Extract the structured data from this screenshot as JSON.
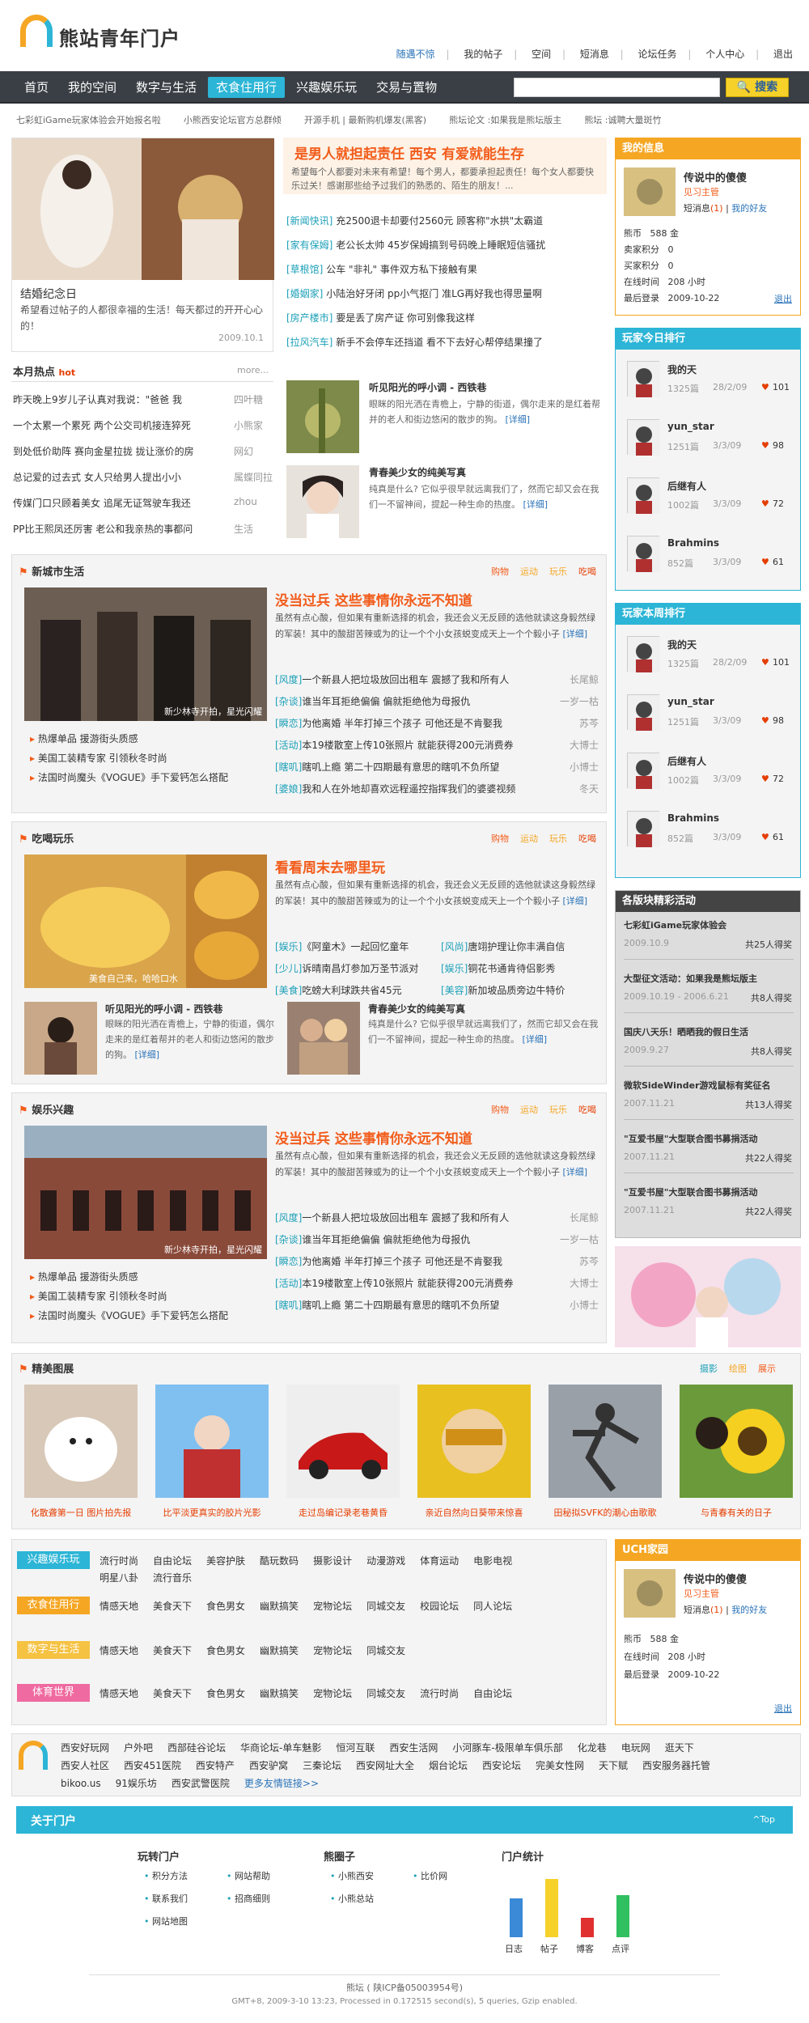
{
  "header": {
    "logo_text": "熊站青年门户",
    "top_links": [
      "随遇不惊",
      "我的帖子",
      "空间",
      "短消息",
      "论坛任务",
      "个人中心",
      "退出"
    ]
  },
  "nav": {
    "items": [
      "首页",
      "我的空间",
      "数字与生活",
      "衣食住用行",
      "兴趣娱乐玩",
      "交易与置物"
    ],
    "active_index": 3,
    "search_label": "搜索"
  },
  "ticker": [
    "七彩虹iGame玩家体验会开始报名啦",
    "小熊西安论坛官方总群倾",
    "开源手机 | 最新购机爆发(黑客)",
    "熊坛论文 :如果我是熊坛版主",
    "熊坛 :诚聘大量斑竹"
  ],
  "hero": {
    "caption_title": "结婚纪念日",
    "caption_text": "希望看过帖子的人都很幸福的生活！每天都过的开开心心的！",
    "date": "2009.10.1"
  },
  "headline": {
    "title": "是男人就担起责任  西安  有爱就能生存",
    "summary": "希望每个人都要对未来有希望！每个男人，都要承担起责任！每个女人都要快乐过关！感谢那些给予过我们的熟悉的、陌生的朋友！...",
    "news": [
      {
        "cat": "[新闻快讯]",
        "text": "充2500退卡却要付2560元 顾客称\"水拱\"太霸道"
      },
      {
        "cat": "[家有保姆]",
        "text": "老公长太帅 45岁保姆搞到号码晚上睡眠短信骚扰"
      },
      {
        "cat": "[草根馆]",
        "text": "公车 \"非礼\" 事件双方私下接触有果"
      },
      {
        "cat": "[婚姻家]",
        "text": "小陆治好牙闭 pp小气抠门 准LG再好我也得思量啊"
      },
      {
        "cat": "[房产楼市]",
        "text": "要是丢了房产证  你可别像我这样"
      },
      {
        "cat": "[拉风汽车]",
        "text": "新手不会停车还挡道  看不下去好心帮停结果撞了"
      }
    ],
    "feature1": {
      "title": "听见阳光的呼小调 - 西铁巷",
      "text": "眼眯的阳光洒在青檐上，宁静的街道，偶尔走来的是红着帮并的老人和街边悠闲的散步的狗。",
      "more": "[详细]"
    },
    "feature2": {
      "title": "青春美少女的纯美写真",
      "text": "纯真是什么? 它似乎很早就远离我们了，然而它却又会在我们一不留神间，提起一种生命的热度。",
      "more": "[详细]"
    }
  },
  "hot": {
    "title": "本月热点",
    "badge": "hot",
    "more": "more...",
    "items": [
      {
        "text": "昨天晚上9岁儿子认真对我说：\"爸爸 我",
        "author": "四叶糖"
      },
      {
        "text": "一个太累一个累死 两个公交司机接连猝死",
        "author": "小熊家"
      },
      {
        "text": "到处低价助阵 赛向金星拉拢 拢让涨价的房",
        "author": "网幻"
      },
      {
        "text": "总记爱的过去式 女人只给男人提出小小",
        "author": "属蝶同拉"
      },
      {
        "text": "传媒门口只顾着美女 追尾无证驾驶车我还",
        "author": "zhou"
      },
      {
        "text": "PP比王熙凤还厉害 老公和我亲热的事都问",
        "author": "生活"
      }
    ]
  },
  "sections": [
    {
      "title": "新城市生活",
      "tabs": [
        "购物",
        "运动",
        "玩乐",
        "吃喝"
      ],
      "img_caption": "新少林寺开拍，星光闪耀",
      "bullets": [
        "热爆单品 援游街头质感",
        "美国工装精专家 引领秋冬时尚",
        "法国时尚魔头《VOGUE》手下爱钙怎么搭配"
      ],
      "headline": "没当过兵  这些事情你永远不知道",
      "summary": "虽然有点心酸，但如果有重新选择的机会，我还会义无反顾的选他就读这身毅然绿的军装！其中的酸甜苦辣或为的让一个个小女孩蜕变成天上一个个毅小子",
      "more": "[详细]",
      "list": [
        {
          "cat": "[风度]",
          "text": "一个新县人把垃圾放回出租车 震撼了我和所有人",
          "author": "长尾鲸"
        },
        {
          "cat": "[杂谈]",
          "text": "谁当年耳拒绝偏偏 偏就拒绝他为母报仇",
          "author": "一岁一枯"
        },
        {
          "cat": "[瞬恋]",
          "text": "为他离婚  半年打掉三个孩子  可他还是不肯娶我",
          "author": "苏芩"
        },
        {
          "cat": "[活动]",
          "text": "本19楼散室上传10张照片 就能获得200元消费券",
          "author": "大博士"
        },
        {
          "cat": "[瞎叽]",
          "text": "瞎叽上瘾 第二十四期最有意思的瞎叽不负所望",
          "author": "小博士"
        },
        {
          "cat": "[婆娘]",
          "text": "我和人在外地却喜欢远程遥控指挥我们的婆婆视频",
          "author": "冬天"
        }
      ]
    },
    {
      "title": "吃喝玩乐",
      "tabs": [
        "购物",
        "运动",
        "玩乐",
        "吃喝"
      ],
      "img_caption": "美食自己来，哈哈口水",
      "headline": "看看周末去哪里玩",
      "summary": "虽然有点心酸，但如果有重新选择的机会，我还会义无反顾的选他就读这身毅然绿的军装！其中的酸甜苦辣或为的让一个个小女孩蜕变成天上一个个毅小子",
      "more": "[详细]",
      "grid": [
        {
          "cat": "[娱乐]",
          "text": "《阿童木》一起回忆童年"
        },
        {
          "cat": "[风尚]",
          "text": "唐翊护理让你丰满自信"
        },
        {
          "cat": "[少儿]",
          "text": "诉晴南昌灯参加万圣节派对"
        },
        {
          "cat": "[娱乐]",
          "text": "铜花书通肯待侣影秀"
        },
        {
          "cat": "[美食]",
          "text": "吃螃大利球跌共省45元"
        },
        {
          "cat": "[美容]",
          "text": "新加坡品质旁边牛特价"
        }
      ],
      "feature1": {
        "title": "听见阳光的呼小调 - 西铁巷",
        "text": "眼眯的阳光洒在青檐上，宁静的街道，偶尔走来的是红着帮并的老人和街边悠闲的散步的狗。",
        "more": "[详细]"
      },
      "feature2": {
        "title": "青春美少女的纯美写真",
        "text": "纯真是什么? 它似乎很早就远离我们了，然而它却又会在我们一不留神间，提起一种生命的热度。",
        "more": "[详细]"
      }
    },
    {
      "title": "娱乐兴趣",
      "tabs": [
        "购物",
        "运动",
        "玩乐",
        "吃喝"
      ],
      "img_caption": "新少林寺开拍，星光闪耀",
      "bullets": [
        "热爆单品 援游街头质感",
        "美国工装精专家 引领秋冬时尚",
        "法国时尚魔头《VOGUE》手下爱钙怎么搭配"
      ],
      "headline": "没当过兵  这些事情你永远不知道",
      "summary": "虽然有点心酸，但如果有重新选择的机会，我还会义无反顾的选他就读这身毅然绿的军装！其中的酸甜苦辣或为的让一个个小女孩蜕变成天上一个个毅小子",
      "more": "[详细]",
      "list": [
        {
          "cat": "[风度]",
          "text": "一个新县人把垃圾放回出租车 震撼了我和所有人",
          "author": "长尾鲸"
        },
        {
          "cat": "[杂谈]",
          "text": "谁当年耳拒绝偏偏 偏就拒绝他为母报仇",
          "author": "一岁一枯"
        },
        {
          "cat": "[瞬恋]",
          "text": "为他离婚  半年打掉三个孩子  可他还是不肯娶我",
          "author": "苏芩"
        },
        {
          "cat": "[活动]",
          "text": "本19楼散室上传10张照片 就能获得200元消费券",
          "author": "大博士"
        },
        {
          "cat": "[瞎叽]",
          "text": "瞎叽上瘾 第二十四期最有意思的瞎叽不负所望",
          "author": "小博士"
        }
      ]
    }
  ],
  "gallery": {
    "title": "精美图展",
    "tabs": [
      "摄影",
      "绘图",
      "展示"
    ],
    "items": [
      "化散聋第一日 图片拍先报",
      "比平淡更真实的胶片光影",
      "走过岛编记录老巷黄昏",
      "亲近自然向日葵带来惊喜",
      "田秘拟SVFK的潮心由歌歌",
      "与青春有关的日子"
    ]
  },
  "tags": [
    {
      "label": "兴趣娱乐玩",
      "color": "#2cb5d6",
      "links": [
        "流行时尚",
        "自由论坛",
        "美容护肤",
        "酷玩数码",
        "摄影设计",
        "动漫游戏",
        "体育运动",
        "电影电视",
        "明星八卦",
        "流行音乐"
      ]
    },
    {
      "label": "衣食住用行",
      "color": "#f5a623",
      "links": [
        "情感天地",
        "美食天下",
        "食色男女",
        "幽默搞笑",
        "宠物论坛",
        "同城交友",
        "校园论坛",
        "同人论坛"
      ]
    },
    {
      "label": "数字与生活",
      "color": "#f5c242",
      "links": [
        "情感天地",
        "美食天下",
        "食色男女",
        "幽默搞笑",
        "宠物论坛",
        "同城交友"
      ]
    },
    {
      "label": "体育世界",
      "color": "#ef6aa0",
      "links": [
        "情感天地",
        "美食天下",
        "食色男女",
        "幽默搞笑",
        "宠物论坛",
        "同城交友",
        "流行时尚",
        "自由论坛"
      ]
    }
  ],
  "friend_links": {
    "row1": [
      "西安好玩网",
      "户外吧",
      "西部硅谷论坛",
      "华商论坛-单车魅影",
      "恒河互联",
      "西安生活网",
      "小河豚车-极限单车俱乐部",
      "化龙巷",
      "电玩网",
      "逛天下"
    ],
    "row2": [
      "西安人社区",
      "西安451医院",
      "西安特产",
      "西安驴窝",
      "三秦论坛",
      "西安网址大全",
      "烟台论坛",
      "西安论坛",
      "完美女性网",
      "天下赋",
      "西安服务器托管"
    ],
    "row3": [
      "bikoo.us",
      "91娱乐坊",
      "西安武警医院"
    ],
    "more": "更多友情链接>>"
  },
  "sidebar": {
    "my_info": {
      "title": "我的信息",
      "name": "传说中的傻傻",
      "level": "见习主管",
      "msg_label": "短消息",
      "msg_count": "(1)",
      "friend_link": "我的好友",
      "stats": [
        {
          "k": "熊币",
          "v": "588 金"
        },
        {
          "k": "卖家积分",
          "v": "0"
        },
        {
          "k": "买家积分",
          "v": "0"
        },
        {
          "k": "在线时间",
          "v": "208 小时"
        },
        {
          "k": "最后登录",
          "v": "2009-10-22"
        }
      ],
      "logout": "退出"
    },
    "today_rank": {
      "title": "玩家今日排行",
      "players": [
        {
          "name": "我的天",
          "posts": "1325篇",
          "date": "28/2/09",
          "likes": "101"
        },
        {
          "name": "yun_star",
          "posts": "1251篇",
          "date": "3/3/09",
          "likes": "98"
        },
        {
          "name": "后继有人",
          "posts": "1002篇",
          "date": "3/3/09",
          "likes": "72"
        },
        {
          "name": "Brahmins",
          "posts": "852篇",
          "date": "3/3/09",
          "likes": "61"
        }
      ]
    },
    "week_rank": {
      "title": "玩家本周排行",
      "players": [
        {
          "name": "我的天",
          "posts": "1325篇",
          "date": "28/2/09",
          "likes": "101"
        },
        {
          "name": "yun_star",
          "posts": "1251篇",
          "date": "3/3/09",
          "likes": "98"
        },
        {
          "name": "后继有人",
          "posts": "1002篇",
          "date": "3/3/09",
          "likes": "72"
        },
        {
          "name": "Brahmins",
          "posts": "852篇",
          "date": "3/3/09",
          "likes": "61"
        }
      ]
    },
    "events": {
      "title": "各版块精彩活动",
      "items": [
        {
          "title": "七彩虹iGame玩家体验会",
          "date": "2009.10.9",
          "count": "共25人得奖"
        },
        {
          "title": "大型征文活动：如果我是熊坛版主",
          "date": "2009.10.19 - 2006.6.21",
          "count": "共8人得奖"
        },
        {
          "title": "国庆八天乐！晒晒我的假日生活",
          "date": "2009.9.27",
          "count": "共8人得奖"
        },
        {
          "title": "微软SideWinder游戏鼠标有奖征名",
          "date": "2007.11.21",
          "count": "共13人得奖"
        },
        {
          "title": "\"互爱书屋\"大型联合图书募捐活动",
          "date": "2007.11.21",
          "count": "共22人得奖"
        },
        {
          "title": "\"互爱书屋\"大型联合图书募捐活动",
          "date": "2007.11.21",
          "count": "共22人得奖"
        }
      ]
    },
    "uch": {
      "title": "UCH家园",
      "name": "传说中的傻傻",
      "level": "见习主管",
      "msg_label": "短消息",
      "msg_count": "(1)",
      "friend_link": "我的好友",
      "stats": [
        {
          "k": "熊币",
          "v": "588 金"
        },
        {
          "k": "在线时间",
          "v": "208 小时"
        },
        {
          "k": "最后登录",
          "v": "2009-10-22"
        }
      ],
      "logout": "退出"
    }
  },
  "about": {
    "title": "关于门户",
    "top": "^Top",
    "col1": {
      "title": "玩转门户",
      "links": [
        "积分方法",
        "网站帮助",
        "联系我们",
        "招商细则",
        "网站地图"
      ]
    },
    "col2": {
      "title": "熊圈子",
      "links": [
        "小熊西安",
        "比价网",
        "小熊总站"
      ]
    },
    "col3": {
      "title": "门户统计",
      "bars": [
        {
          "label": "日志",
          "value": 60
        },
        {
          "label": "帖子",
          "value": 90
        },
        {
          "label": "博客",
          "value": 30
        },
        {
          "label": "点评",
          "value": 65
        }
      ]
    }
  },
  "footer": {
    "line1": "熊坛  ( 陕ICP备05003954号)",
    "line2": "GMT+8, 2009-3-10 13:23, Processed in 0.172515 second(s), 5 queries, Gzip enabled."
  },
  "colors": {
    "accent": "#2cb5d6",
    "orange": "#f25c1b",
    "yellow": "#f5a623",
    "nav": "#3a3f45"
  }
}
